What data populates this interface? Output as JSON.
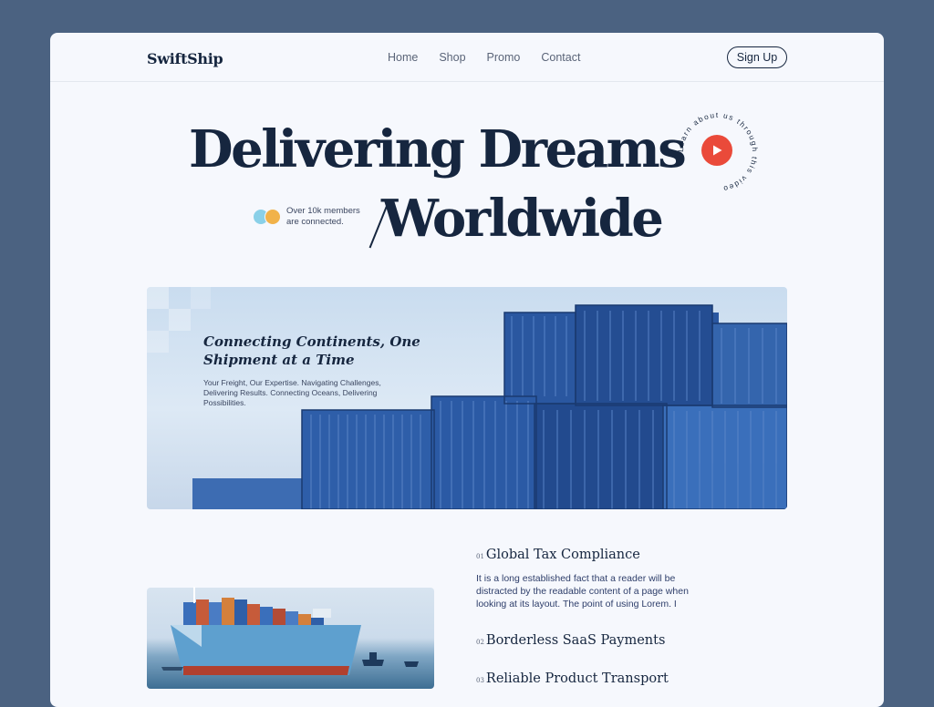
{
  "brand": "SwiftShip",
  "nav": {
    "items": [
      "Home",
      "Shop",
      "Promo",
      "Contact"
    ],
    "signup_label": "Sign Up"
  },
  "hero": {
    "title_line1": "Delivering Dreams",
    "title_line2": "Worldwide",
    "members_text": "Over 10k members are connected.",
    "video_label": "Learn about us through this video",
    "play_icon": "play-icon"
  },
  "banner": {
    "title": "Connecting Continents, One Shipment at a Time",
    "text": "Your Freight, Our Expertise. Navigating Challenges, Delivering Results. Connecting Oceans, Delivering Possibilities."
  },
  "features": [
    {
      "num": "01",
      "title": "Global Tax Compliance",
      "desc": "It is a long established fact that a reader will be distracted by the readable content of a page when looking at its layout. The point of using Lorem. I"
    },
    {
      "num": "02",
      "title": "Borderless SaaS Payments"
    },
    {
      "num": "03",
      "title": "Reliable Product Transport"
    }
  ],
  "colors": {
    "page_bg": "#4b6281",
    "card_bg": "#f6f8fd",
    "text_dark": "#16263f",
    "accent_red": "#ea4a3a",
    "container_blue": "#2f5fa8"
  }
}
